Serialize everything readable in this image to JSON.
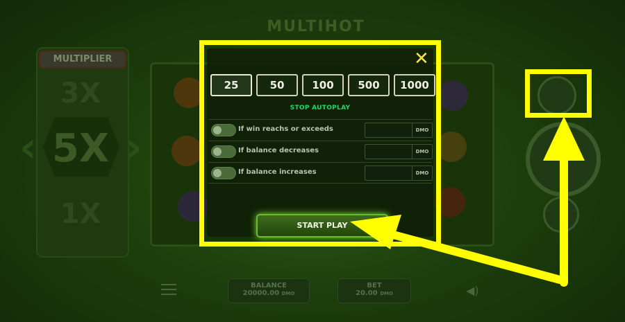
{
  "background": {
    "logo_text": "MULTIHOT",
    "multiplier_title": "MULTIPLIER",
    "multiplier_values": [
      "3X",
      "5X",
      "1X"
    ],
    "balance_label": "BALANCE",
    "balance_value": "20000.00",
    "bet_label": "BET",
    "bet_value": "20.00",
    "currency": "DMO"
  },
  "autoplay": {
    "spin_options": [
      "25",
      "50",
      "100",
      "500",
      "1000"
    ],
    "selected_option": "25",
    "stop_label": "STOP AUTOPLAY",
    "conditions": [
      {
        "label": "If win reachs or exceeds",
        "currency": "DMO",
        "enabled": false
      },
      {
        "label": "If balance decreases",
        "currency": "DMO",
        "enabled": false
      },
      {
        "label": "If balance increases",
        "currency": "DMO",
        "enabled": false
      }
    ],
    "start_label": "START PLAY",
    "close_icon": "close-x-icon"
  },
  "colors": {
    "highlight": "#ffff00",
    "accent_green": "#1fd86a",
    "close_yellow": "#f7e24c"
  }
}
